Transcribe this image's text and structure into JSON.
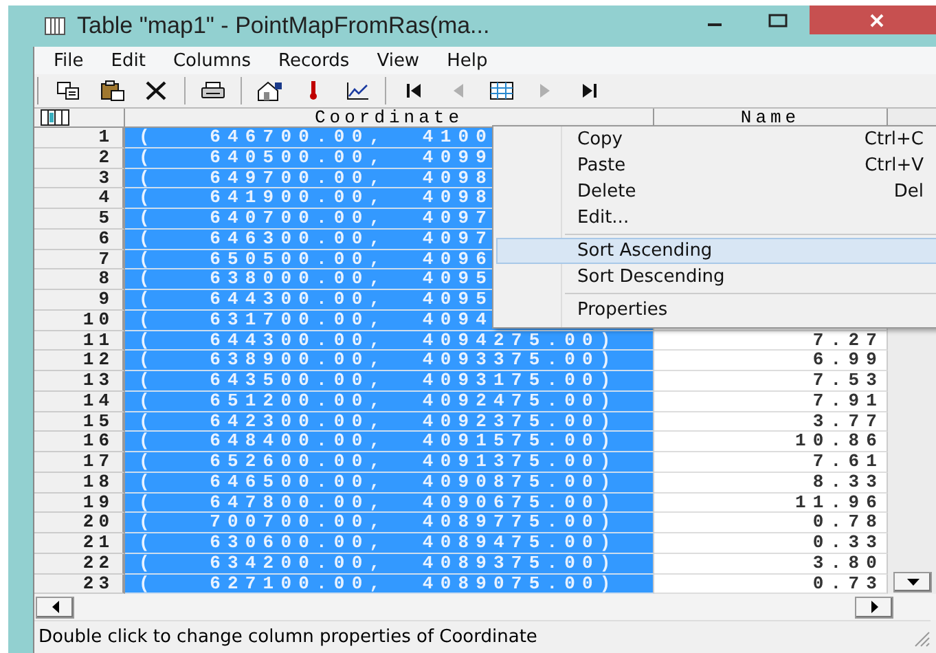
{
  "window": {
    "title": "Table \"map1\" - PointMapFromRas(ma..."
  },
  "menu_bar": [
    "File",
    "Edit",
    "Columns",
    "Records",
    "View",
    "Help"
  ],
  "toolbar": [
    {
      "kind": "copy",
      "disabled": false
    },
    {
      "kind": "paste",
      "disabled": false
    },
    {
      "kind": "delete",
      "disabled": false
    },
    {
      "kind": "separator"
    },
    {
      "kind": "print",
      "disabled": false
    },
    {
      "kind": "separator"
    },
    {
      "kind": "properties",
      "disabled": false
    },
    {
      "kind": "pin",
      "disabled": false
    },
    {
      "kind": "graph",
      "disabled": false
    },
    {
      "kind": "separator"
    },
    {
      "kind": "first",
      "disabled": false
    },
    {
      "kind": "prev",
      "disabled": true
    },
    {
      "kind": "grid",
      "disabled": false
    },
    {
      "kind": "next",
      "disabled": true
    },
    {
      "kind": "last",
      "disabled": false
    }
  ],
  "table": {
    "columns": [
      {
        "label": "Coordinate",
        "selected": true
      },
      {
        "label": "Name",
        "selected": false
      }
    ],
    "rows": [
      {
        "number": "1",
        "coordinate": "(   646700.00,  4100"
      },
      {
        "number": "2",
        "coordinate": "(   640500.00,  4099"
      },
      {
        "number": "3",
        "coordinate": "(   649700.00,  4098"
      },
      {
        "number": "4",
        "coordinate": "(   641900.00,  4098"
      },
      {
        "number": "5",
        "coordinate": "(   640700.00,  4097"
      },
      {
        "number": "6",
        "coordinate": "(   646300.00,  4097"
      },
      {
        "number": "7",
        "coordinate": "(   650500.00,  4096"
      },
      {
        "number": "8",
        "coordinate": "(   638000.00,  4095"
      },
      {
        "number": "9",
        "coordinate": "(   644300.00,  4095"
      },
      {
        "number": "10",
        "coordinate": "(   631700.00,  4094"
      },
      {
        "number": "11",
        "coordinate": "(   644300.00,  4094275.00)",
        "name": "7.27"
      },
      {
        "number": "12",
        "coordinate": "(   638900.00,  4093375.00)",
        "name": "6.99"
      },
      {
        "number": "13",
        "coordinate": "(   643500.00,  4093175.00)",
        "name": "7.53"
      },
      {
        "number": "14",
        "coordinate": "(   651200.00,  4092475.00)",
        "name": "7.91"
      },
      {
        "number": "15",
        "coordinate": "(   642300.00,  4092375.00)",
        "name": "3.77"
      },
      {
        "number": "16",
        "coordinate": "(   648400.00,  4091575.00)",
        "name": "10.86"
      },
      {
        "number": "17",
        "coordinate": "(   652600.00,  4091375.00)",
        "name": "7.61"
      },
      {
        "number": "18",
        "coordinate": "(   646500.00,  4090875.00)",
        "name": "8.33"
      },
      {
        "number": "19",
        "coordinate": "(   647800.00,  4090675.00)",
        "name": "11.96"
      },
      {
        "number": "20",
        "coordinate": "(   700700.00,  4089775.00)",
        "name": "0.78"
      },
      {
        "number": "21",
        "coordinate": "(   630600.00,  4089475.00)",
        "name": "0.33"
      },
      {
        "number": "22",
        "coordinate": "(   634200.00,  4089375.00)",
        "name": "3.80"
      },
      {
        "number": "23",
        "coordinate": "(   627100.00,  4089075.00)",
        "name": "0.73"
      }
    ]
  },
  "context_menu": [
    {
      "kind": "item",
      "label": "Copy",
      "shortcut": "Ctrl+C",
      "selected": false
    },
    {
      "kind": "item",
      "label": "Paste",
      "shortcut": "Ctrl+V",
      "selected": false
    },
    {
      "kind": "item",
      "label": "Delete",
      "shortcut": "Del",
      "selected": false
    },
    {
      "kind": "item",
      "label": "Edit...",
      "selected": false
    },
    {
      "kind": "separator"
    },
    {
      "kind": "item",
      "label": "Sort Ascending",
      "selected": true
    },
    {
      "kind": "item",
      "label": "Sort Descending",
      "selected": false
    },
    {
      "kind": "separator"
    },
    {
      "kind": "item",
      "label": "Properties",
      "selected": false
    }
  ],
  "status_bar": "Double click to change column properties of Coordinate"
}
